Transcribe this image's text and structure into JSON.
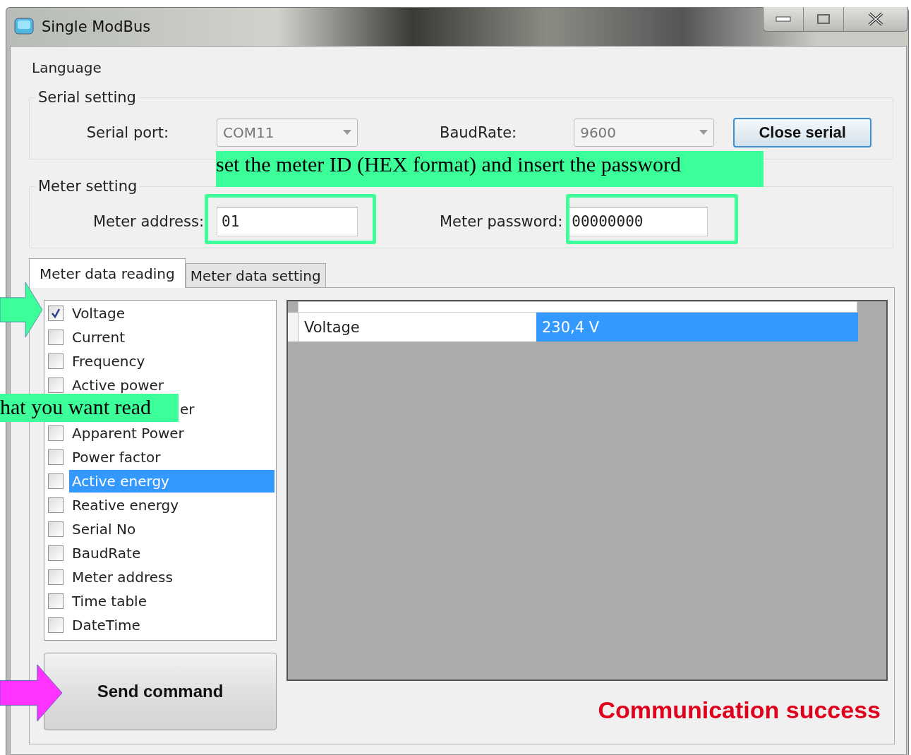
{
  "window": {
    "title": "Single ModBus"
  },
  "menu": [
    {
      "label": "Language"
    }
  ],
  "serial_setting": {
    "title": "Serial setting",
    "port_label": "Serial port:",
    "port_value": "COM11",
    "baud_label": "BaudRate:",
    "baud_value": "9600",
    "button": "Close serial"
  },
  "meter_setting": {
    "title": "Meter setting",
    "address_label": "Meter address:",
    "address_value": "01",
    "password_label": "Meter password:",
    "password_value": "00000000"
  },
  "tabs": [
    {
      "label": "Meter data reading",
      "selected": true
    },
    {
      "label": "Meter data setting",
      "selected": false
    }
  ],
  "items": [
    {
      "label": "Voltage",
      "checked": true,
      "selected": false
    },
    {
      "label": "Current",
      "checked": false,
      "selected": false
    },
    {
      "label": "Frequency",
      "checked": false,
      "selected": false
    },
    {
      "label": "Active power",
      "checked": false,
      "selected": false
    },
    {
      "label": "er",
      "selected": false
    },
    {
      "label": "Apparent Power",
      "checked": false,
      "selected": false
    },
    {
      "label": "Power factor",
      "checked": false,
      "selected": false
    },
    {
      "label": "Active energy",
      "checked": false,
      "selected": true
    },
    {
      "label": "Reative energy",
      "checked": false,
      "selected": false
    },
    {
      "label": "Serial No",
      "checked": false,
      "selected": false
    },
    {
      "label": "BaudRate",
      "checked": false,
      "selected": false
    },
    {
      "label": "Meter address",
      "checked": false,
      "selected": false
    },
    {
      "label": "Time table",
      "checked": false,
      "selected": false
    },
    {
      "label": "DateTime",
      "checked": false,
      "selected": false
    }
  ],
  "table": {
    "rows": [
      {
        "name": "Voltage",
        "value": "230,4 V",
        "selected": true
      }
    ]
  },
  "send_button": "Send command",
  "status": "Communication success",
  "annotations": [
    {
      "kind": "label",
      "text": "set the meter ID (HEX format) and insert the password"
    },
    {
      "kind": "outline"
    },
    {
      "kind": "outline"
    },
    {
      "kind": "arrow",
      "color": "#3cff9a"
    },
    {
      "kind": "label",
      "text": "hat you want read"
    },
    {
      "kind": "arrow",
      "color": "#ff33ff"
    }
  ]
}
